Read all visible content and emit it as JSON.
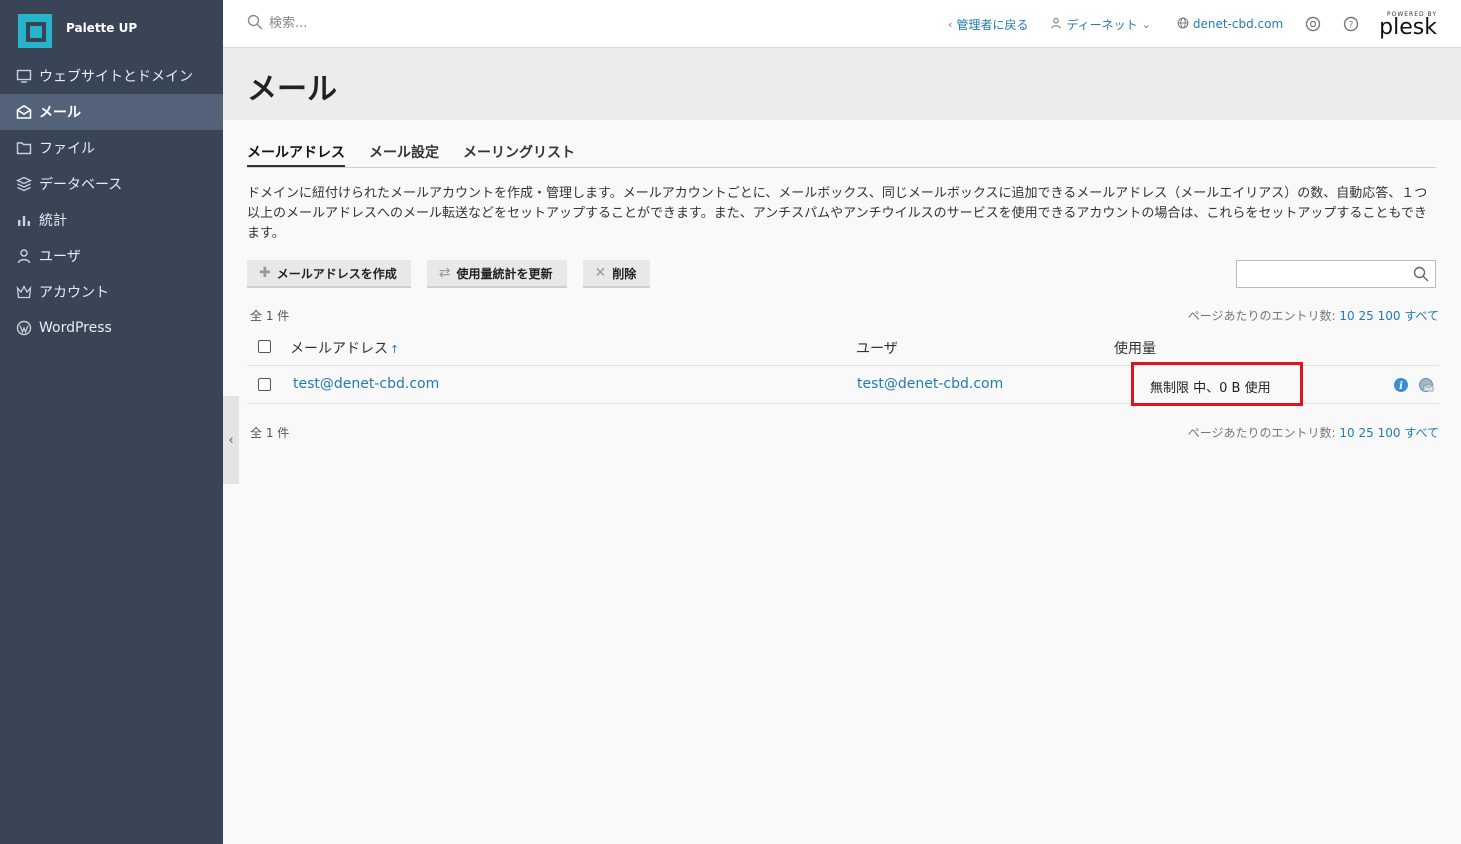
{
  "brand": {
    "name": "Palette UP"
  },
  "sidebar": {
    "items": [
      {
        "label": "ウェブサイトとドメイン",
        "icon": "monitor-icon",
        "active": false
      },
      {
        "label": "メール",
        "icon": "mail-icon",
        "active": true
      },
      {
        "label": "ファイル",
        "icon": "folder-icon",
        "active": false
      },
      {
        "label": "データベース",
        "icon": "database-icon",
        "active": false
      },
      {
        "label": "統計",
        "icon": "bar-chart-icon",
        "active": false
      },
      {
        "label": "ユーザ",
        "icon": "user-icon",
        "active": false
      },
      {
        "label": "アカウント",
        "icon": "crown-icon",
        "active": false
      },
      {
        "label": "WordPress",
        "icon": "wordpress-icon",
        "active": false
      }
    ]
  },
  "topbar": {
    "search_placeholder": "検索...",
    "back_link": "管理者に戻る",
    "user_link": "ディーネット",
    "domain_link": "denet-cbd.com",
    "powered_by": "POWERED BY",
    "plesk": "plesk"
  },
  "page": {
    "title": "メール",
    "tabs": [
      {
        "label": "メールアドレス",
        "active": true
      },
      {
        "label": "メール設定",
        "active": false
      },
      {
        "label": "メーリングリスト",
        "active": false
      }
    ],
    "description": "ドメインに紐付けられたメールアカウントを作成・管理します。メールアカウントごとに、メールボックス、同じメールボックスに追加できるメールアドレス（メールエイリアス）の数、自動応答、１つ以上のメールアドレスへのメール転送などをセットアップすることができます。また、アンチスパムやアンチウイルスのサービスを使用できるアカウントの場合は、これらをセットアップすることもできます。"
  },
  "toolbar": {
    "create_label": "メールアドレスを作成",
    "update_stats_label": "使用量統計を更新",
    "delete_label": "削除"
  },
  "list": {
    "total_text": "全 1 件",
    "per_page_label": "ページあたりのエントリ数:",
    "per_page_options": [
      "10",
      "25",
      "100",
      "すべて"
    ],
    "columns": {
      "email": "メールアドレス",
      "user": "ユーザ",
      "usage": "使用量"
    },
    "rows": [
      {
        "email": "test@denet-cbd.com",
        "user": "test@denet-cbd.com",
        "usage": "無制限 中、0 B 使用"
      }
    ]
  },
  "colors": {
    "sidebar_bg": "#394557",
    "link": "#1f7bb5",
    "highlight_box": "#e0141e"
  }
}
